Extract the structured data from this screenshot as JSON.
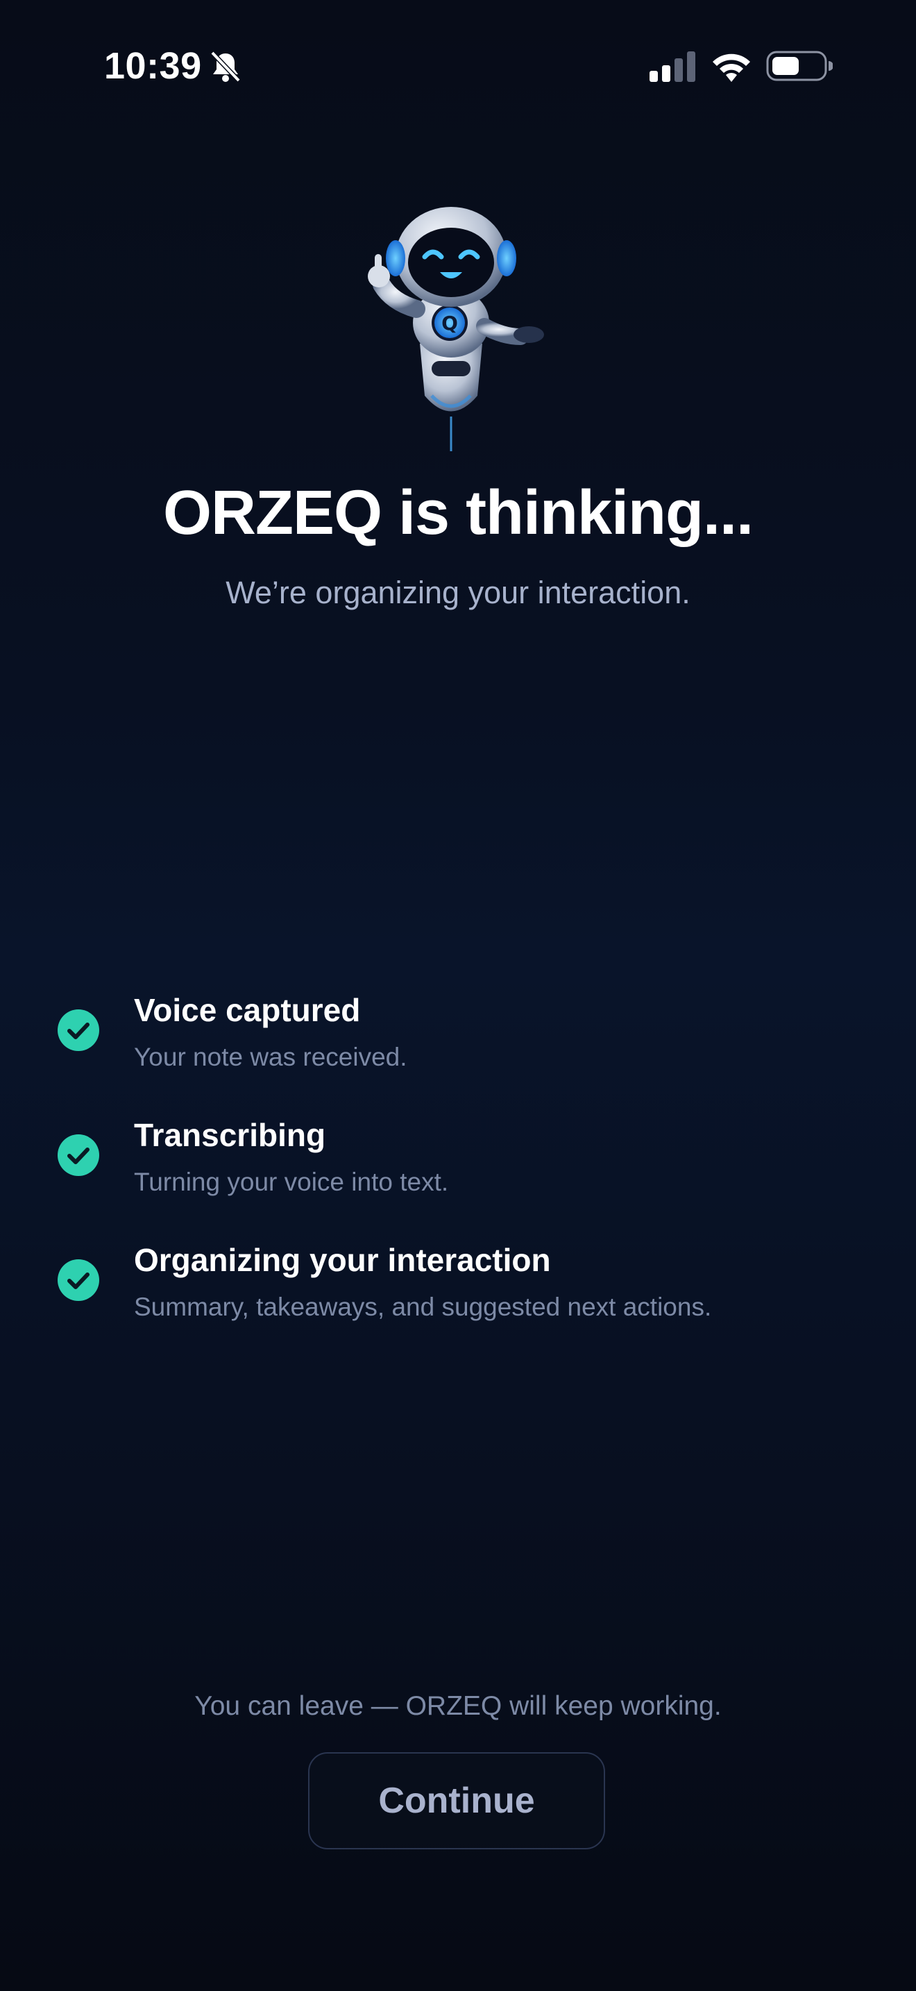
{
  "status_bar": {
    "time": "10:39",
    "icons": [
      "bell-slash-icon",
      "signal-icon",
      "wifi-icon",
      "battery-icon"
    ]
  },
  "header": {
    "mascot": "robot-mascot-icon",
    "title": "ORZEQ is thinking...",
    "subtitle": "We’re organizing your interaction."
  },
  "steps": [
    {
      "title": "Voice captured",
      "description": "Your note was received.",
      "status": "done"
    },
    {
      "title": "Transcribing",
      "description": "Turning your voice into text.",
      "status": "done"
    },
    {
      "title": "Organizing your interaction",
      "description": "Summary, takeaways, and suggested next actions.",
      "status": "done"
    }
  ],
  "footer": {
    "note": "You can leave — ORZEQ will keep working.",
    "continue_label": "Continue"
  },
  "colors": {
    "background": "#070c18",
    "accent_check": "#2ed1b0",
    "muted_text": "#7d8aa6"
  }
}
